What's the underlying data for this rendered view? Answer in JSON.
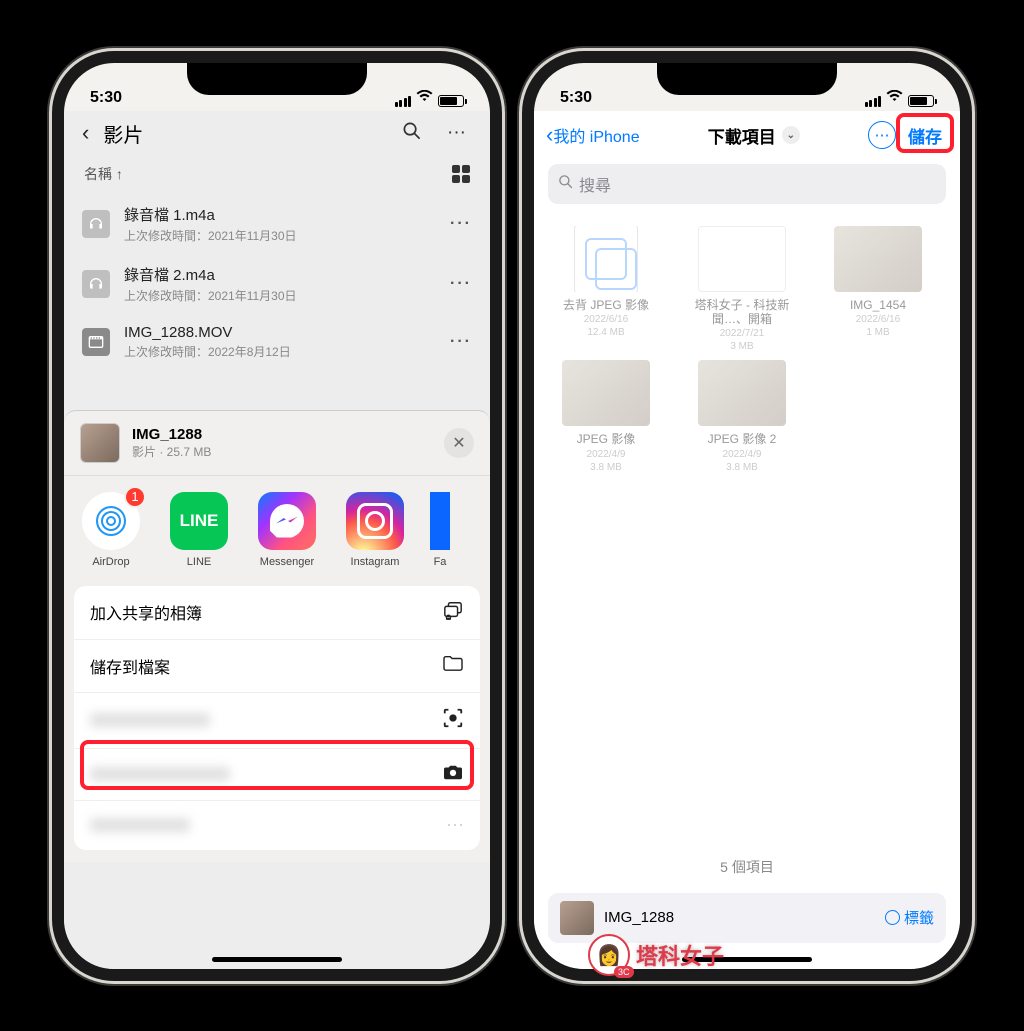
{
  "status": {
    "time": "5:30"
  },
  "left": {
    "nav_title": "影片",
    "sort_label": "名稱 ↑",
    "files": [
      {
        "name": "錄音檔 1.m4a",
        "sub": "上次修改時間：2021年11月30日"
      },
      {
        "name": "錄音檔 2.m4a",
        "sub": "上次修改時間：2021年11月30日"
      },
      {
        "name": "IMG_1288.MOV",
        "sub": "上次修改時間：2022年8月12日"
      }
    ],
    "share": {
      "name": "IMG_1288",
      "sub": "影片 · 25.7 MB",
      "apps": [
        {
          "label": "AirDrop",
          "badge": "1"
        },
        {
          "label": "LINE"
        },
        {
          "label": "Messenger"
        },
        {
          "label": "Instagram"
        },
        {
          "label": "Fa"
        }
      ],
      "actions": {
        "shared_album": "加入共享的相簿",
        "save_to_files": "儲存到檔案"
      }
    }
  },
  "right": {
    "back_label": "我的 iPhone",
    "title": "下載項目",
    "save_label": "儲存",
    "search_placeholder": "搜尋",
    "items": [
      {
        "name": "去背 JPEG 影像",
        "date": "2022/6/16",
        "size": "12.4 MB"
      },
      {
        "name": "塔科女子 - 科技新聞…、開箱",
        "date": "2022/7/21",
        "size": "3 MB"
      },
      {
        "name": "IMG_1454",
        "date": "2022/6/16",
        "size": "1 MB"
      },
      {
        "name": "JPEG 影像",
        "date": "2022/4/9",
        "size": "3.8 MB"
      },
      {
        "name": "JPEG 影像 2",
        "date": "2022/4/9",
        "size": "3.8 MB"
      }
    ],
    "footer": "5 個項目",
    "pending": {
      "name": "IMG_1288",
      "tags_label": "標籤"
    }
  },
  "watermark": "塔科女子"
}
